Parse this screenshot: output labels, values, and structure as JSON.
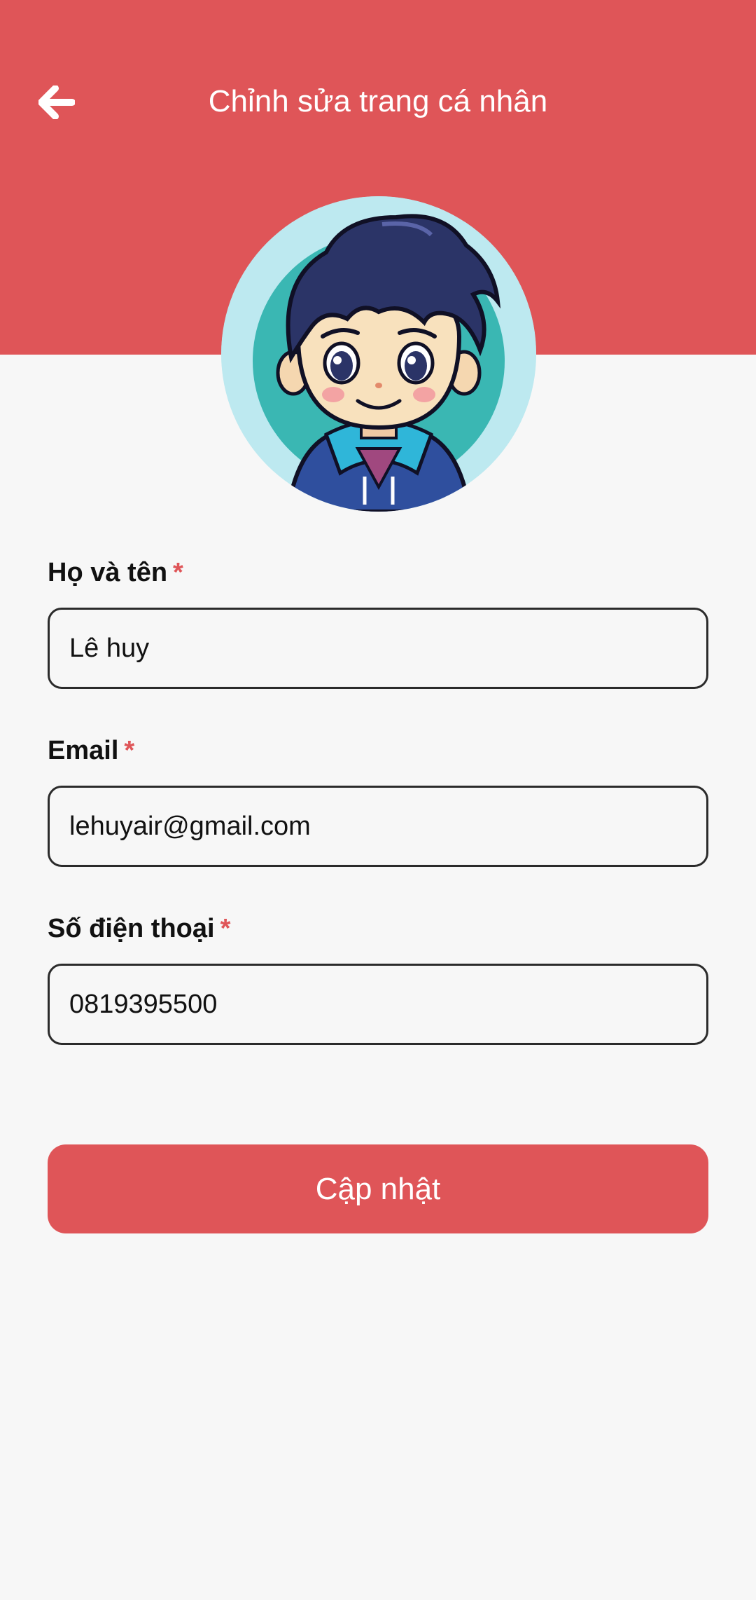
{
  "header": {
    "title": "Chỉnh sửa trang cá nhân",
    "back_icon": "arrow-left-icon",
    "background_color": "#df5558"
  },
  "avatar": {
    "icon": "cartoon-boy-avatar"
  },
  "form": {
    "required_marker": "*",
    "full_name": {
      "label": "Họ và tên",
      "value": "Lê huy"
    },
    "email": {
      "label": "Email",
      "value": "lehuyair@gmail.com"
    },
    "phone": {
      "label": "Số điện thoại",
      "value": "0819395500"
    }
  },
  "actions": {
    "update_label": "Cập nhật",
    "accent_color": "#df5558"
  }
}
